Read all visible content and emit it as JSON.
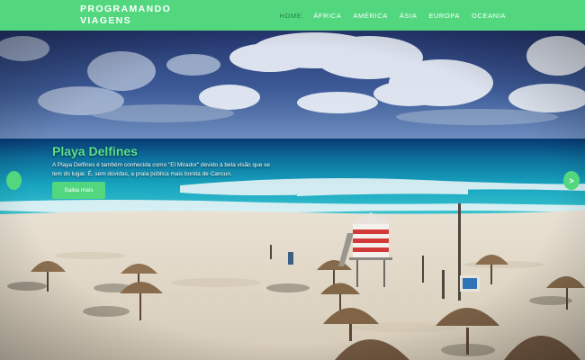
{
  "brand": {
    "line1": "PROGRAMANDO",
    "line2": "VIAGENS"
  },
  "nav": {
    "items": [
      "HOME",
      "ÁFRICA",
      "AMÉRICA",
      "ÁSIA",
      "EUROPA",
      "OCEANIA"
    ],
    "active": "HOME"
  },
  "hero": {
    "title": "Playa Delfines",
    "description": "A Playa Delfines é também conhecida como \"El Mirador\" devido à bela visão que se tem do lugar. É, sem dúvidas, a praia pública mais bonita de Cancun.",
    "button_label": "Saiba mais",
    "next_symbol": ">"
  },
  "colors": {
    "accent": "#52d77f",
    "accent_text": "#5ce08a",
    "nav_active": "#2f7e4a"
  }
}
